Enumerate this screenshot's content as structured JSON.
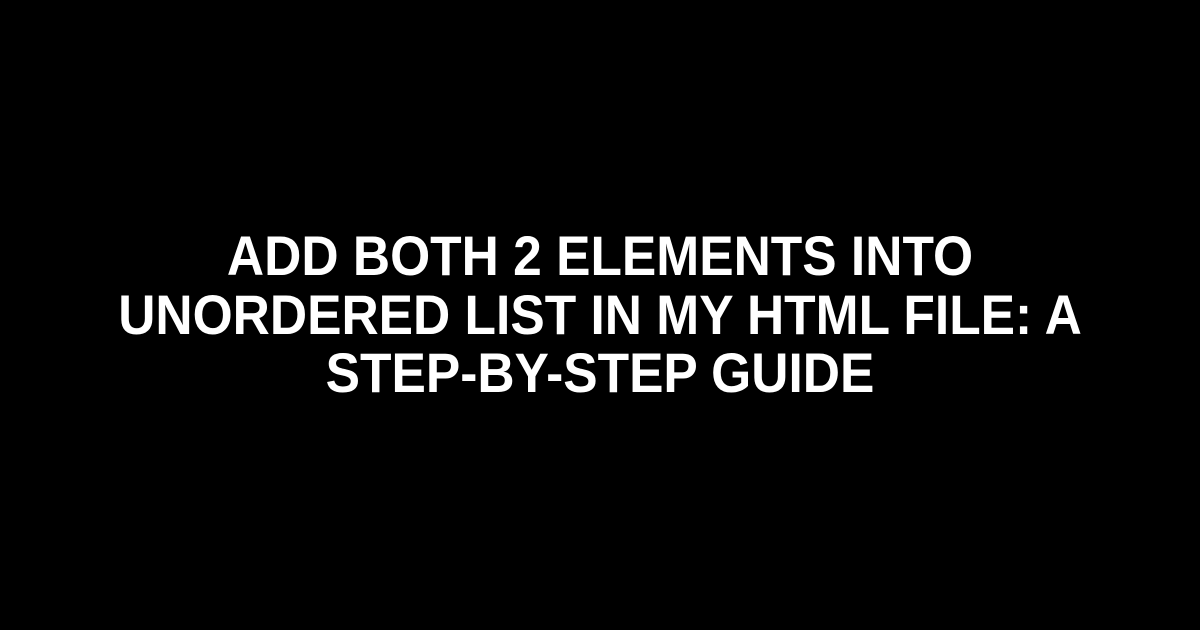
{
  "title": "Add Both 2 Elements into Unordered List in My HTML File: A Step-by-Step Guide"
}
